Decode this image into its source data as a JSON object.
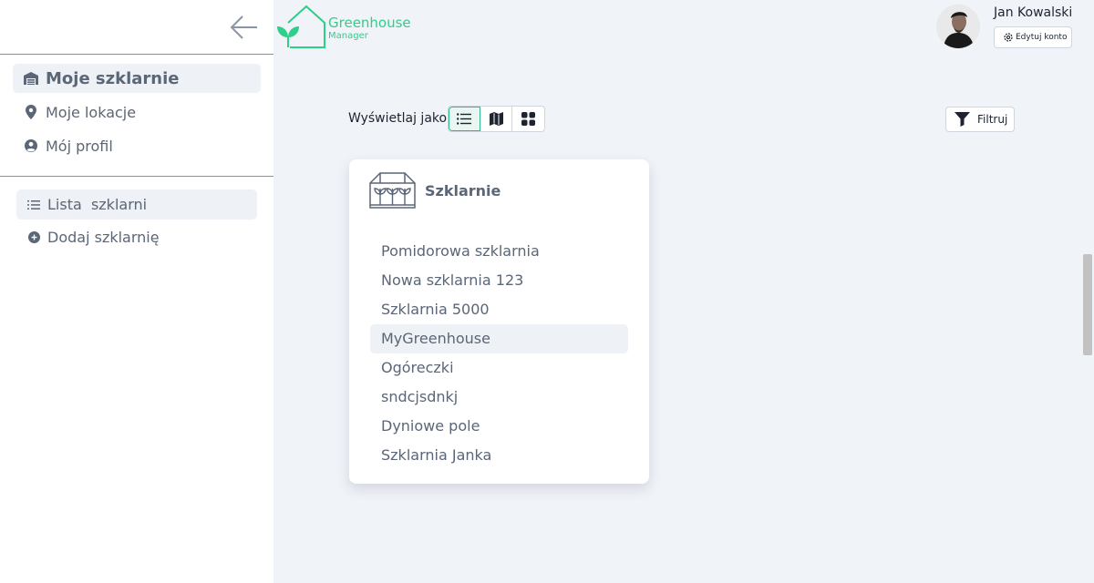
{
  "app": {
    "logo_title": "Greenhouse",
    "logo_subtitle": "Manager",
    "accent": "#2fcf8a"
  },
  "sidebar": {
    "main_items": [
      {
        "label": "Moje szklarnie",
        "icon": "warehouse-icon",
        "active": true
      },
      {
        "label": "Moje lokacje",
        "icon": "map-pin-icon"
      },
      {
        "label": "Mój profil",
        "icon": "user-circle-icon"
      }
    ],
    "sub_items": [
      {
        "label": "Lista  szklarni",
        "icon": "list-icon",
        "active": true
      },
      {
        "label": "Dodaj szklarnię",
        "icon": "plus-circle-icon"
      }
    ]
  },
  "user": {
    "name": "Jan Kowalski",
    "edit_label": "Edytuj konto"
  },
  "toolbar": {
    "view_label": "Wyświetlaj jako",
    "view_modes": [
      "list",
      "map",
      "grid"
    ],
    "active_view": "list",
    "filter_label": "Filtruj"
  },
  "card": {
    "title": "Szklarnie",
    "items": [
      "Pomidorowa szklarnia",
      "Nowa szklarnia 123",
      "Szklarnia 5000",
      "MyGreenhouse",
      "Ogóreczki",
      "sndcjsdnkj",
      "Dyniowe pole",
      "Szklarnia Janka"
    ],
    "highlighted_item": "MyGreenhouse"
  }
}
